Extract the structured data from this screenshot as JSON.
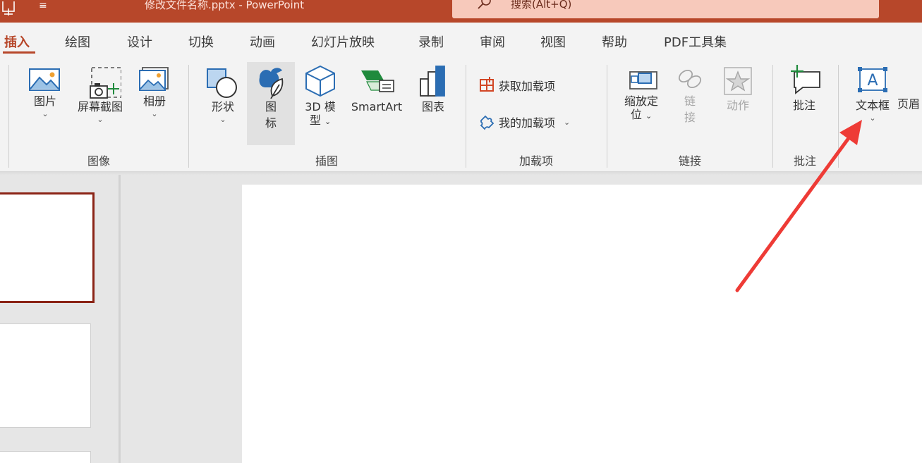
{
  "titlebar": {
    "qa_glyph": "≡",
    "title": "修改文件名称.pptx  -  PowerPoint",
    "search_text": "搜索(Alt+Q)"
  },
  "tabs": [
    {
      "label": "插入",
      "active": true
    },
    {
      "label": "绘图"
    },
    {
      "label": "设计"
    },
    {
      "label": "切换"
    },
    {
      "label": "动画"
    },
    {
      "label": "幻灯片放映"
    },
    {
      "label": "录制"
    },
    {
      "label": "审阅"
    },
    {
      "label": "视图"
    },
    {
      "label": "帮助"
    },
    {
      "label": "PDF工具集"
    }
  ],
  "ribbon": {
    "images": {
      "group_label": "图像",
      "picture": "图片",
      "screenshot": "屏幕截图",
      "album": "相册"
    },
    "illustrations": {
      "group_label": "插图",
      "shapes": "形状",
      "icons_line1": "图",
      "icons_line2": "标",
      "model_line1": "3D 模",
      "model_line2": "型",
      "smartart": "SmartArt",
      "chart": "图表"
    },
    "addins": {
      "group_label": "加载项",
      "get_addins": "获取加载项",
      "my_addins": "我的加载项"
    },
    "links": {
      "group_label": "链接",
      "zoom_line1": "缩放定",
      "zoom_line2": "位",
      "link_line1": "链",
      "link_line2": "接",
      "action": "动作"
    },
    "comments": {
      "group_label": "批注",
      "comment": "批注"
    },
    "text": {
      "textbox": "文本框",
      "header_partial": "页眉"
    },
    "chevron": "⌄"
  },
  "colors": {
    "accent": "#b7472a",
    "search_bg": "#f7c9bb",
    "ribbon_bg": "#f3f3f3",
    "workspace_bg": "#e6e6e6",
    "selected_thumb_border": "#8b2416",
    "annotation_arrow": "#ee3b36",
    "icon_blue": "#2b6db3",
    "icon_green": "#1f8a3c"
  }
}
